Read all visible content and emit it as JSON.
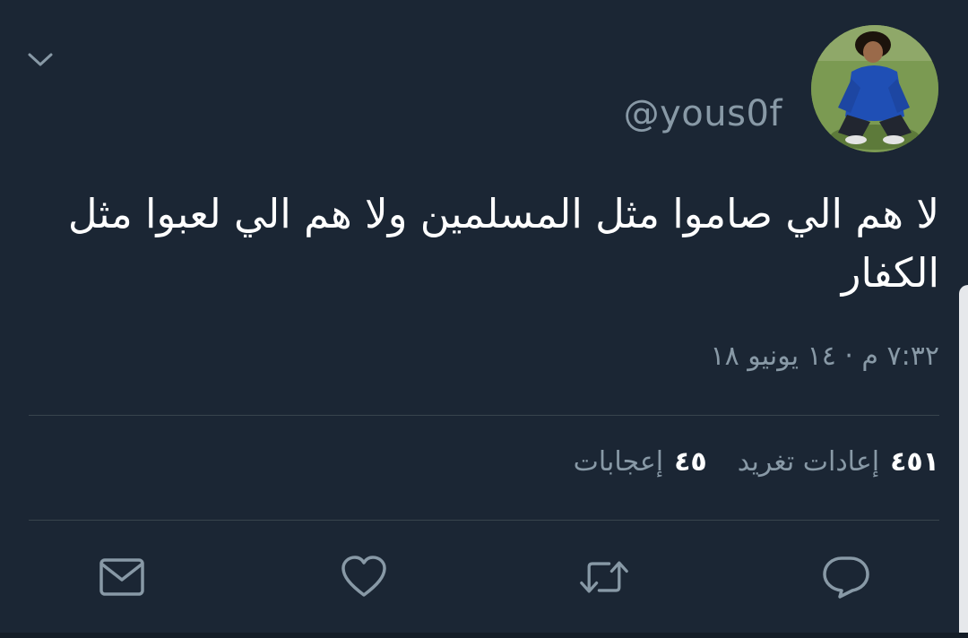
{
  "tweet": {
    "handle": "@yous0f",
    "text": "لا هم الي صاموا مثل المسلمين ولا هم الي لعبوا مثل الكفار",
    "timestamp": "٧:٣٢ م · ١٤ يونيو ١٨"
  },
  "stats": {
    "retweets_count": "٤٥١",
    "retweets_label": "إعادات تغريد",
    "likes_count": "٤٥",
    "likes_label": "إعجابات"
  },
  "icons": {
    "menu": "chevron-down-icon",
    "reply": "reply-bubble-icon",
    "retweet": "retweet-icon",
    "like": "heart-icon",
    "message": "envelope-icon"
  },
  "colors": {
    "background": "#1b2634",
    "text": "#ffffff",
    "muted": "#8899a6",
    "divider": "#38444d"
  }
}
